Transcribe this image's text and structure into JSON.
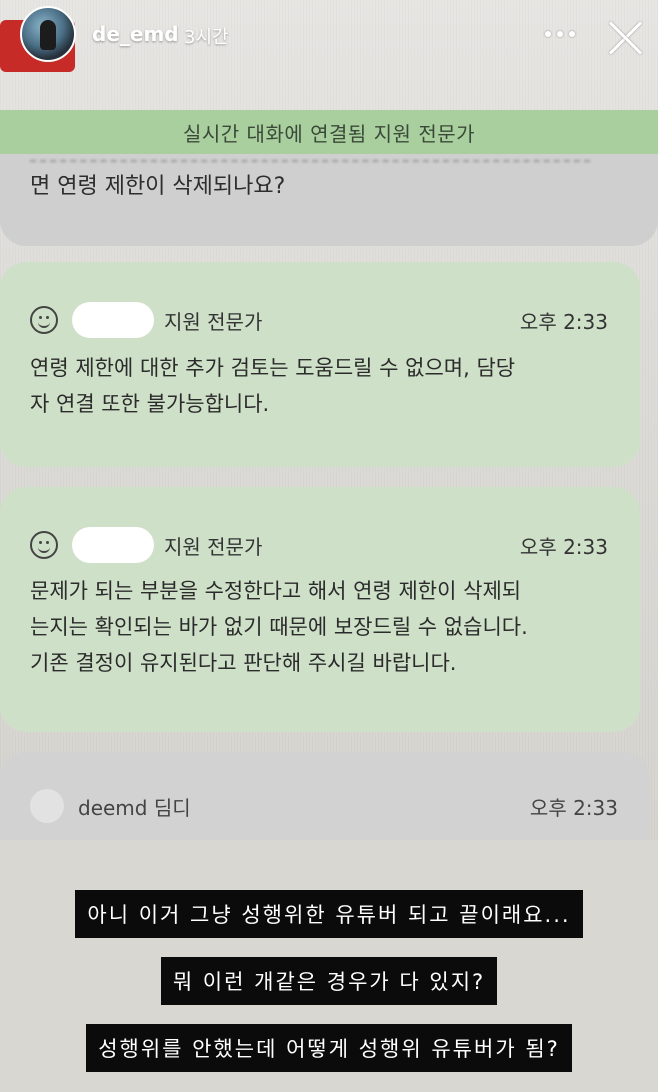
{
  "story_header": {
    "username": "de_emd",
    "time_ago": "3시간"
  },
  "chat": {
    "banner": "실시간 대화에 연결됨 지원 전문가",
    "user_message_tail": "면 연령 제한이 삭제되나요?",
    "messages": [
      {
        "sender": "지원 전문가",
        "time": "오후 2:33",
        "lines": [
          "연령 제한에 대한 추가 검토는 도움드릴 수 없으며, 담당",
          "자 연결 또한 불가능합니다."
        ]
      },
      {
        "sender": "지원 전문가",
        "time": "오후 2:33",
        "lines": [
          "문제가 되는 부분을 수정한다고 해서 연령 제한이 삭제되",
          "는지는 확인되는 바가 없기 때문에 보장드릴 수 없습니다.",
          "기존 결정이 유지된다고 판단해 주시길 바랍니다."
        ]
      }
    ],
    "user_row": {
      "name": "deemd 딤디",
      "time": "오후 2:33"
    }
  },
  "captions": [
    "아니 이거 그냥 성행위한 유튜버 되고 끝이래요...",
    "뭐 이런 개같은 경우가 다 있지?",
    "성행위를 안했는데 어떻게 성행위 유튜버가 됨?"
  ],
  "icons": [
    "smile-icon",
    "more-icon",
    "close-icon"
  ],
  "colors": {
    "banner": "#a9cf9f",
    "agent_bubble": "#cfe0c9",
    "caption_bg": "#0b0b0b"
  }
}
